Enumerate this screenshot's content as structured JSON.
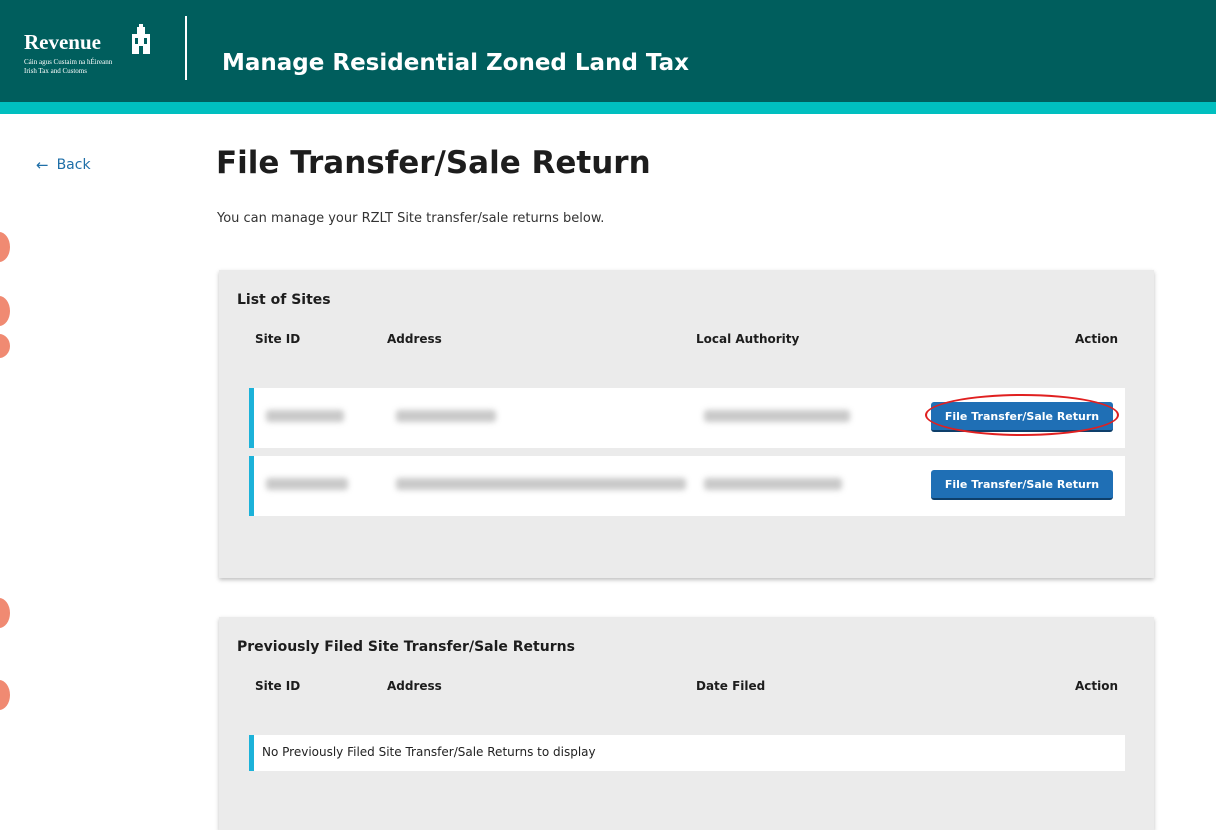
{
  "header": {
    "brand_name": "Revenue",
    "brand_sub1": "Cáin agus Custaim na hÉireann",
    "brand_sub2": "Irish Tax and Customs",
    "app_title": "Manage Residential Zoned Land Tax"
  },
  "nav": {
    "back_label": "Back"
  },
  "page": {
    "title": "File Transfer/Sale Return",
    "intro": "You can manage your RZLT Site transfer/sale returns below."
  },
  "sites_panel": {
    "title": "List of Sites",
    "columns": {
      "site_id": "Site ID",
      "address": "Address",
      "local_authority": "Local Authority",
      "action": "Action"
    },
    "rows": [
      {
        "action_label": "File Transfer/Sale Return"
      },
      {
        "action_label": "File Transfer/Sale Return"
      }
    ]
  },
  "prev_panel": {
    "title": "Previously Filed Site Transfer/Sale Returns",
    "columns": {
      "site_id": "Site ID",
      "address": "Address",
      "date_filed": "Date Filed",
      "action": "Action"
    },
    "empty_message": "No Previously Filed Site Transfer/Sale Returns to display"
  },
  "colors": {
    "header_bg": "#005e5d",
    "header_strip": "#00bfbf",
    "button_bg": "#1f6fb5",
    "row_accent": "#1cb2d9",
    "highlight": "#e02020"
  }
}
